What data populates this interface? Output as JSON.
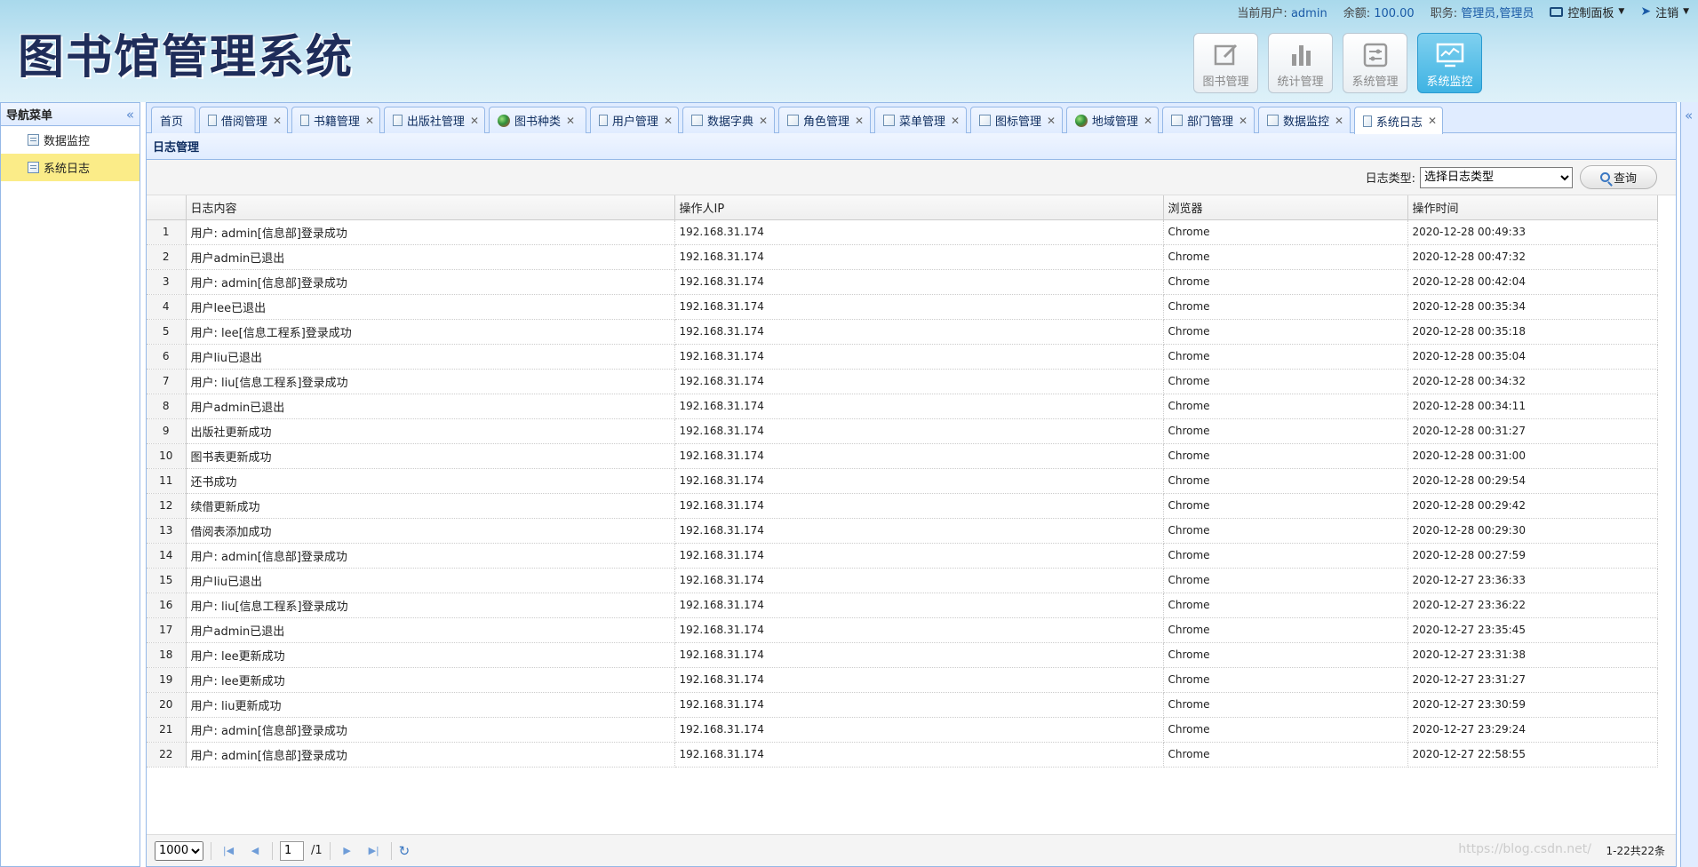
{
  "app": {
    "title": "图书馆管理系统"
  },
  "topbar": {
    "user_label": "当前用户:",
    "user_value": "admin",
    "balance_label": "余额:",
    "balance_value": "100.00",
    "role_label": "职务:",
    "role_value": "管理员,管理员",
    "control_panel": "控制面板",
    "logout": "注销"
  },
  "modules": [
    {
      "label": "图书管理",
      "icon": "edit-icon"
    },
    {
      "label": "统计管理",
      "icon": "bar-chart-icon"
    },
    {
      "label": "系统管理",
      "icon": "sliders-icon"
    },
    {
      "label": "系统监控",
      "icon": "monitor-icon",
      "active": true
    }
  ],
  "sidebar": {
    "title": "导航菜单",
    "items": [
      {
        "label": "数据监控",
        "active": false
      },
      {
        "label": "系统日志",
        "active": true
      }
    ]
  },
  "tabs": [
    {
      "label": "首页",
      "closable": false,
      "icon": "none"
    },
    {
      "label": "借阅管理",
      "closable": true,
      "icon": "doc"
    },
    {
      "label": "书籍管理",
      "closable": true,
      "icon": "doc"
    },
    {
      "label": "出版社管理",
      "closable": true,
      "icon": "doc"
    },
    {
      "label": "图书种类",
      "closable": true,
      "icon": "globe"
    },
    {
      "label": "用户管理",
      "closable": true,
      "icon": "doc"
    },
    {
      "label": "数据字典",
      "closable": true,
      "icon": "doc"
    },
    {
      "label": "角色管理",
      "closable": true,
      "icon": "doc"
    },
    {
      "label": "菜单管理",
      "closable": true,
      "icon": "doc"
    },
    {
      "label": "图标管理",
      "closable": true,
      "icon": "doc"
    },
    {
      "label": "地域管理",
      "closable": true,
      "icon": "globe"
    },
    {
      "label": "部门管理",
      "closable": true,
      "icon": "doc"
    },
    {
      "label": "数据监控",
      "closable": true,
      "icon": "doc"
    },
    {
      "label": "系统日志",
      "closable": true,
      "icon": "doc",
      "active": true
    }
  ],
  "panel": {
    "title": "日志管理"
  },
  "filter": {
    "label": "日志类型:",
    "selected": "选择日志类型",
    "query_button": "查询"
  },
  "table": {
    "columns": [
      "日志内容",
      "操作人IP",
      "浏览器",
      "操作时间"
    ],
    "rows": [
      [
        "用户: admin[信息部]登录成功",
        "192.168.31.174",
        "Chrome",
        "2020-12-28 00:49:33"
      ],
      [
        "用户admin已退出",
        "192.168.31.174",
        "Chrome",
        "2020-12-28 00:47:32"
      ],
      [
        "用户: admin[信息部]登录成功",
        "192.168.31.174",
        "Chrome",
        "2020-12-28 00:42:04"
      ],
      [
        "用户lee已退出",
        "192.168.31.174",
        "Chrome",
        "2020-12-28 00:35:34"
      ],
      [
        "用户: lee[信息工程系]登录成功",
        "192.168.31.174",
        "Chrome",
        "2020-12-28 00:35:18"
      ],
      [
        "用户liu已退出",
        "192.168.31.174",
        "Chrome",
        "2020-12-28 00:35:04"
      ],
      [
        "用户: liu[信息工程系]登录成功",
        "192.168.31.174",
        "Chrome",
        "2020-12-28 00:34:32"
      ],
      [
        "用户admin已退出",
        "192.168.31.174",
        "Chrome",
        "2020-12-28 00:34:11"
      ],
      [
        "出版社更新成功",
        "192.168.31.174",
        "Chrome",
        "2020-12-28 00:31:27"
      ],
      [
        "图书表更新成功",
        "192.168.31.174",
        "Chrome",
        "2020-12-28 00:31:00"
      ],
      [
        "还书成功",
        "192.168.31.174",
        "Chrome",
        "2020-12-28 00:29:54"
      ],
      [
        "续借更新成功",
        "192.168.31.174",
        "Chrome",
        "2020-12-28 00:29:42"
      ],
      [
        "借阅表添加成功",
        "192.168.31.174",
        "Chrome",
        "2020-12-28 00:29:30"
      ],
      [
        "用户: admin[信息部]登录成功",
        "192.168.31.174",
        "Chrome",
        "2020-12-28 00:27:59"
      ],
      [
        "用户liu已退出",
        "192.168.31.174",
        "Chrome",
        "2020-12-27 23:36:33"
      ],
      [
        "用户: liu[信息工程系]登录成功",
        "192.168.31.174",
        "Chrome",
        "2020-12-27 23:36:22"
      ],
      [
        "用户admin已退出",
        "192.168.31.174",
        "Chrome",
        "2020-12-27 23:35:45"
      ],
      [
        "用户: lee更新成功",
        "192.168.31.174",
        "Chrome",
        "2020-12-27 23:31:38"
      ],
      [
        "用户: lee更新成功",
        "192.168.31.174",
        "Chrome",
        "2020-12-27 23:31:27"
      ],
      [
        "用户: liu更新成功",
        "192.168.31.174",
        "Chrome",
        "2020-12-27 23:30:59"
      ],
      [
        "用户: admin[信息部]登录成功",
        "192.168.31.174",
        "Chrome",
        "2020-12-27 23:29:24"
      ],
      [
        "用户: admin[信息部]登录成功",
        "192.168.31.174",
        "Chrome",
        "2020-12-27 22:58:55"
      ]
    ]
  },
  "pager": {
    "page_size": "1000",
    "page": "1",
    "total_pages": "/1",
    "info": "1-22共22条"
  },
  "watermark": "https://blog.csdn.net/"
}
